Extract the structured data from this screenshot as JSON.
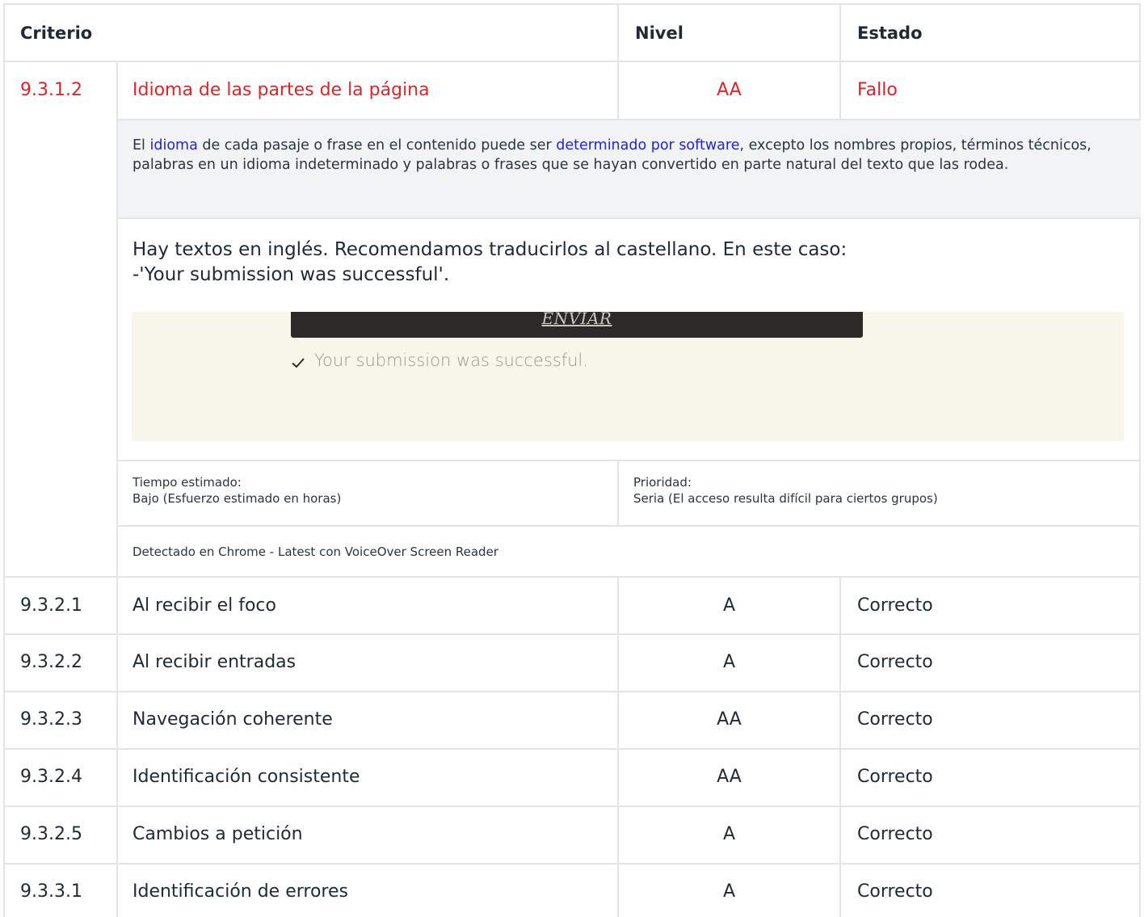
{
  "table": {
    "headers": {
      "criterio": "Criterio",
      "nivel": "Nivel",
      "estado": "Estado"
    },
    "failed_item": {
      "id": "9.3.1.2",
      "name": "Idioma de las partes de la página",
      "level": "AA",
      "status": "Fallo",
      "description": {
        "part1": "El ",
        "link1": "idioma",
        "part2": " de cada pasaje o frase en el contenido puede ser ",
        "link2": "determinado por software",
        "part3": ", excepto los nombres propios, términos técnicos, palabras en un idioma indeterminado y palabras o frases que se hayan convertido en parte natural del texto que las rodea."
      },
      "comment_line1": "Hay textos en inglés. Recomendamos traducirlos al castellano. En este caso:",
      "comment_line2": "-'Your submission was successful'.",
      "screenshot": {
        "button_label": "ENVIAR",
        "message": "Your submission was successful.",
        "check_icon": "check-icon"
      },
      "time_label": "Tiempo estimado:",
      "time_value": "Bajo (Esfuerzo estimado en horas)",
      "priority_label": "Prioridad:",
      "priority_value": "Seria (El acceso resulta difícil para ciertos grupos)",
      "detected": "Detectado en Chrome - Latest con VoiceOver Screen Reader"
    },
    "rows": [
      {
        "id": "9.3.2.1",
        "name": "Al recibir el foco",
        "level": "A",
        "status": "Correcto"
      },
      {
        "id": "9.3.2.2",
        "name": "Al recibir entradas",
        "level": "A",
        "status": "Correcto"
      },
      {
        "id": "9.3.2.3",
        "name": "Navegación coherente",
        "level": "AA",
        "status": "Correcto"
      },
      {
        "id": "9.3.2.4",
        "name": "Identificación consistente",
        "level": "AA",
        "status": "Correcto"
      },
      {
        "id": "9.3.2.5",
        "name": "Cambios a petición",
        "level": "A",
        "status": "Correcto"
      },
      {
        "id": "9.3.3.1",
        "name": "Identificación de errores",
        "level": "A",
        "status": "Correcto"
      }
    ],
    "colors": {
      "fail": "#e02424",
      "link": "#2222d8",
      "border": "#e1e4e8",
      "description_bg": "#f1f3f5",
      "screenshot_bg": "#f8f6ea"
    }
  }
}
